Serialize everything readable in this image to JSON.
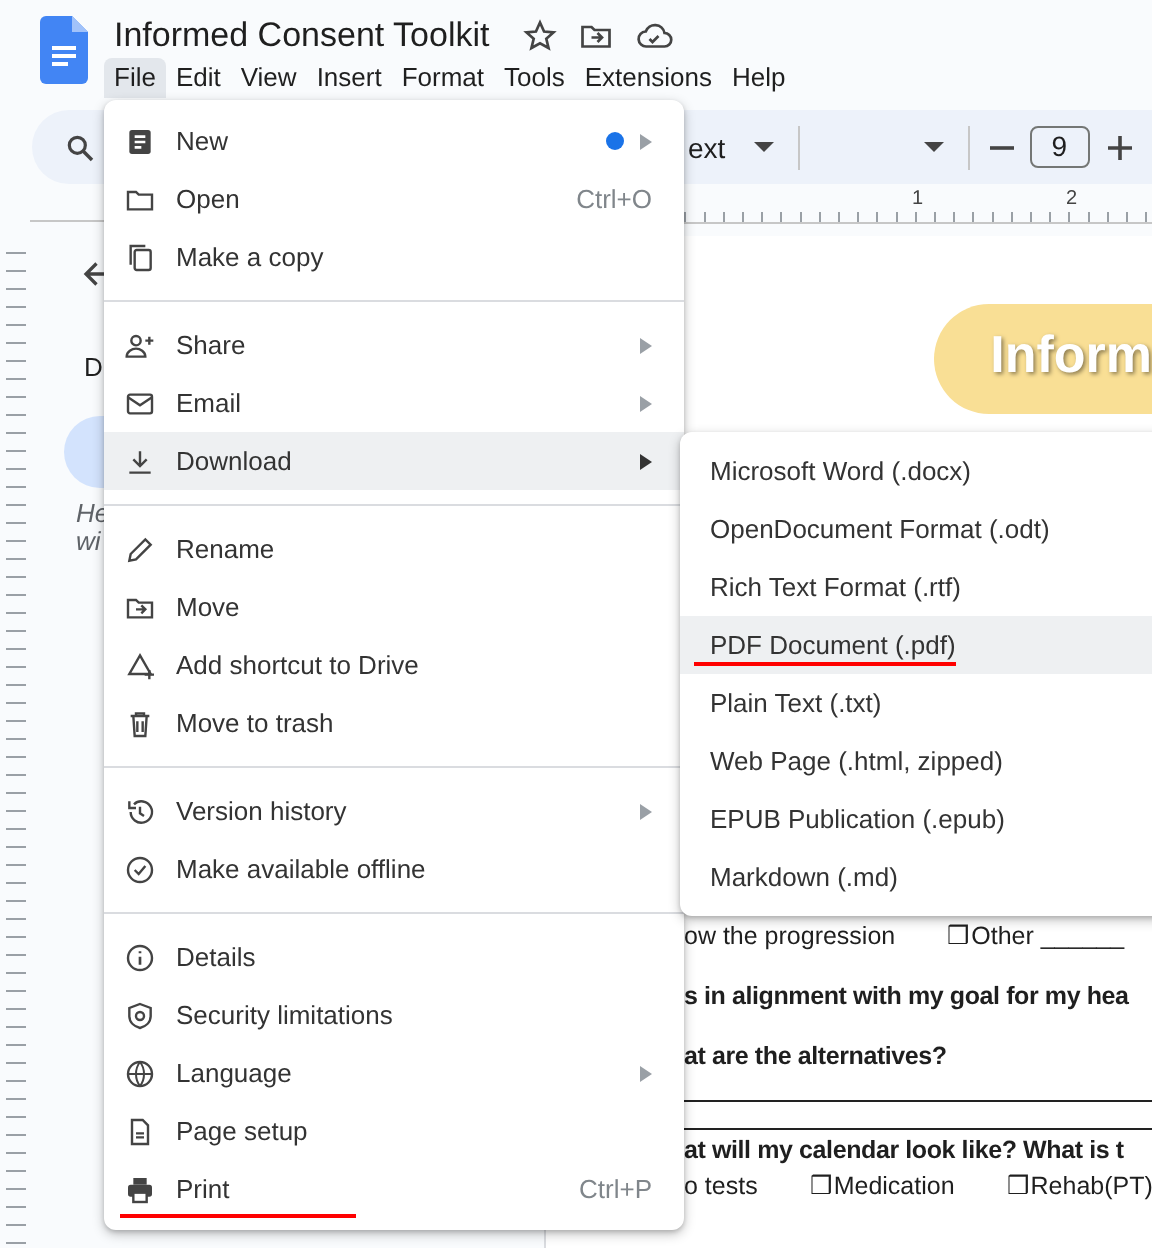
{
  "header": {
    "title": "Informed Consent Toolkit",
    "menus": [
      {
        "label": "File",
        "selected": true
      },
      {
        "label": "Edit",
        "selected": false
      },
      {
        "label": "View",
        "selected": false
      },
      {
        "label": "Insert",
        "selected": false
      },
      {
        "label": "Format",
        "selected": false
      },
      {
        "label": "Tools",
        "selected": false
      },
      {
        "label": "Extensions",
        "selected": false
      },
      {
        "label": "Help",
        "selected": false
      }
    ]
  },
  "toolbar": {
    "style_text": "ext",
    "font_size": "9"
  },
  "ruler": {
    "labels": [
      "1",
      "2"
    ]
  },
  "outline": {
    "heading": "D",
    "hint_lines": [
      "He",
      "wi"
    ]
  },
  "document": {
    "banner": "Inform",
    "lines": [
      {
        "kind": "options",
        "parts": [
          "ow the progression",
          "❒Other ______"
        ]
      },
      {
        "kind": "question",
        "text": "s in alignment with my goal for my hea"
      },
      {
        "kind": "question",
        "text": "at are the alternatives?"
      },
      {
        "kind": "blank"
      },
      {
        "kind": "blank"
      },
      {
        "kind": "question",
        "text": "at will my calendar look like? What is t"
      },
      {
        "kind": "options",
        "parts": [
          "o tests",
          "❒Medication",
          "❒Rehab(PT)"
        ]
      }
    ]
  },
  "file_menu": {
    "sections": [
      [
        {
          "label": "New",
          "submenu": true,
          "new_dot": true,
          "selected": false,
          "underlined": false
        },
        {
          "label": "Open",
          "shortcut": "Ctrl+O",
          "submenu": false,
          "selected": false,
          "underlined": false
        },
        {
          "label": "Make a copy",
          "submenu": false,
          "selected": false,
          "underlined": false
        }
      ],
      [
        {
          "label": "Share",
          "submenu": true,
          "selected": false,
          "underlined": false
        },
        {
          "label": "Email",
          "submenu": true,
          "selected": false,
          "underlined": false
        },
        {
          "label": "Download",
          "submenu": true,
          "selected": true,
          "underlined": false
        }
      ],
      [
        {
          "label": "Rename",
          "submenu": false,
          "selected": false,
          "underlined": false
        },
        {
          "label": "Move",
          "submenu": false,
          "selected": false,
          "underlined": false
        },
        {
          "label": "Add shortcut to Drive",
          "submenu": false,
          "selected": false,
          "underlined": false
        },
        {
          "label": "Move to trash",
          "submenu": false,
          "selected": false,
          "underlined": false
        }
      ],
      [
        {
          "label": "Version history",
          "submenu": true,
          "selected": false,
          "underlined": false
        },
        {
          "label": "Make available offline",
          "submenu": false,
          "selected": false,
          "underlined": false
        }
      ],
      [
        {
          "label": "Details",
          "submenu": false,
          "selected": false,
          "underlined": false
        },
        {
          "label": "Security limitations",
          "submenu": false,
          "selected": false,
          "underlined": false
        },
        {
          "label": "Language",
          "submenu": true,
          "selected": false,
          "underlined": false
        },
        {
          "label": "Page setup",
          "submenu": false,
          "selected": false,
          "underlined": false
        },
        {
          "label": "Print",
          "shortcut": "Ctrl+P",
          "submenu": false,
          "selected": false,
          "underlined": true
        }
      ]
    ]
  },
  "download_submenu": {
    "items": [
      {
        "label": "Microsoft Word (.docx)",
        "selected": false,
        "underlined": false
      },
      {
        "label": "OpenDocument Format (.odt)",
        "selected": false,
        "underlined": false
      },
      {
        "label": "Rich Text Format (.rtf)",
        "selected": false,
        "underlined": false
      },
      {
        "label": "PDF Document (.pdf)",
        "selected": true,
        "underlined": true
      },
      {
        "label": "Plain Text (.txt)",
        "selected": false,
        "underlined": false
      },
      {
        "label": "Web Page (.html, zipped)",
        "selected": false,
        "underlined": false
      },
      {
        "label": "EPUB Publication (.epub)",
        "selected": false,
        "underlined": false
      },
      {
        "label": "Markdown (.md)",
        "selected": false,
        "underlined": false
      }
    ]
  }
}
